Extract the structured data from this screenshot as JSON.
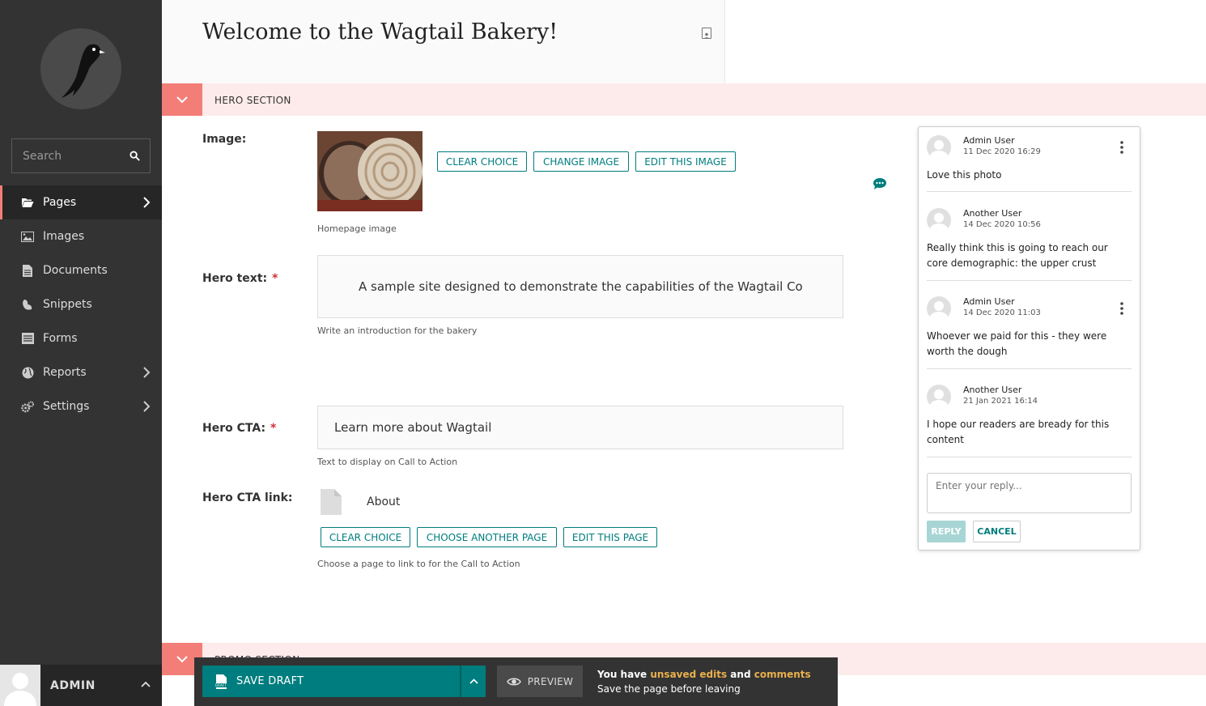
{
  "sidebar": {
    "search_placeholder": "Search",
    "items": [
      {
        "label": "Pages"
      },
      {
        "label": "Images"
      },
      {
        "label": "Documents"
      },
      {
        "label": "Snippets"
      },
      {
        "label": "Forms"
      },
      {
        "label": "Reports"
      },
      {
        "label": "Settings"
      }
    ],
    "account_name": "ADMIN"
  },
  "header": {
    "title": "Welcome to the Wagtail Bakery!"
  },
  "sections": {
    "hero": "HERO SECTION",
    "promo": "PROMO SECTION"
  },
  "form": {
    "image_label": "Image:",
    "image_buttons": {
      "clear": "CLEAR CHOICE",
      "change": "CHANGE IMAGE",
      "edit": "EDIT THIS IMAGE"
    },
    "image_help": "Homepage image",
    "hero_text_label": "Hero text:",
    "hero_text_value": "A sample site designed to demonstrate the capabilities of the Wagtail Conte",
    "hero_text_help": "Write an introduction for the bakery",
    "hero_cta_label": "Hero CTA:",
    "hero_cta_value": "Learn more about Wagtail",
    "hero_cta_help": "Text to display on Call to Action",
    "hero_cta_link_label": "Hero CTA link:",
    "hero_cta_link_page": "About",
    "link_buttons": {
      "clear": "CLEAR CHOICE",
      "choose": "CHOOSE ANOTHER PAGE",
      "edit": "EDIT THIS PAGE"
    },
    "hero_cta_link_help": "Choose a page to link to for the Call to Action",
    "required_marker": "*"
  },
  "comments": [
    {
      "author": "Admin User",
      "date": "11 Dec 2020 16:29",
      "text": "Love this photo"
    },
    {
      "author": "Another User",
      "date": "14 Dec 2020 10:56",
      "text": "Really think this is going to reach our core demographic: the upper crust"
    },
    {
      "author": "Admin User",
      "date": "14 Dec 2020 11:03",
      "text": "Whoever we paid for this - they were worth the dough"
    },
    {
      "author": "Another User",
      "date": "21 Jan 2021 16:14",
      "text": "I hope our readers are bready for this content"
    }
  ],
  "reply": {
    "placeholder": "Enter your reply...",
    "reply_label": "REPLY",
    "cancel_label": "CANCEL"
  },
  "footer": {
    "save_draft": "SAVE DRAFT",
    "preview": "PREVIEW",
    "warn_prefix": "You have ",
    "warn_edits": "unsaved edits",
    "warn_and": " and ",
    "warn_comments": "comments",
    "warn_line2": "Save the page before leaving"
  },
  "colors": {
    "sidebar": "#333333",
    "accent": "#f37e77",
    "teal": "#007d7e",
    "warning": "#e9b04d"
  }
}
